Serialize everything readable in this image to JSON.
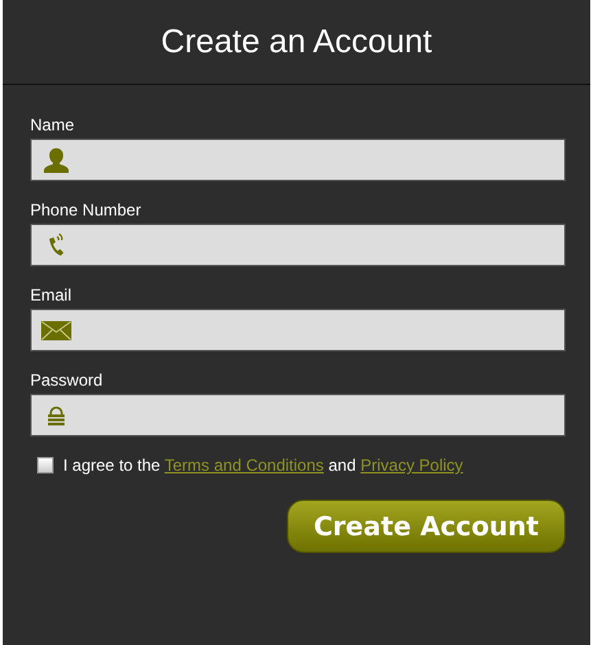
{
  "title": "Create an Account",
  "fields": [
    {
      "label": "Name",
      "kind": "person"
    },
    {
      "label": "Phone Number",
      "kind": "phone"
    },
    {
      "label": "Email",
      "kind": "mail"
    },
    {
      "label": "Password",
      "kind": "lock"
    }
  ],
  "agreement": {
    "checked": false,
    "parts": [
      {
        "kind": "text",
        "text": "I agree to the "
      },
      {
        "kind": "link",
        "text": "Terms and Conditions"
      },
      {
        "kind": "text",
        "text": " and "
      },
      {
        "kind": "link",
        "text": "Privacy Policy"
      }
    ]
  },
  "submit": "Create Account"
}
